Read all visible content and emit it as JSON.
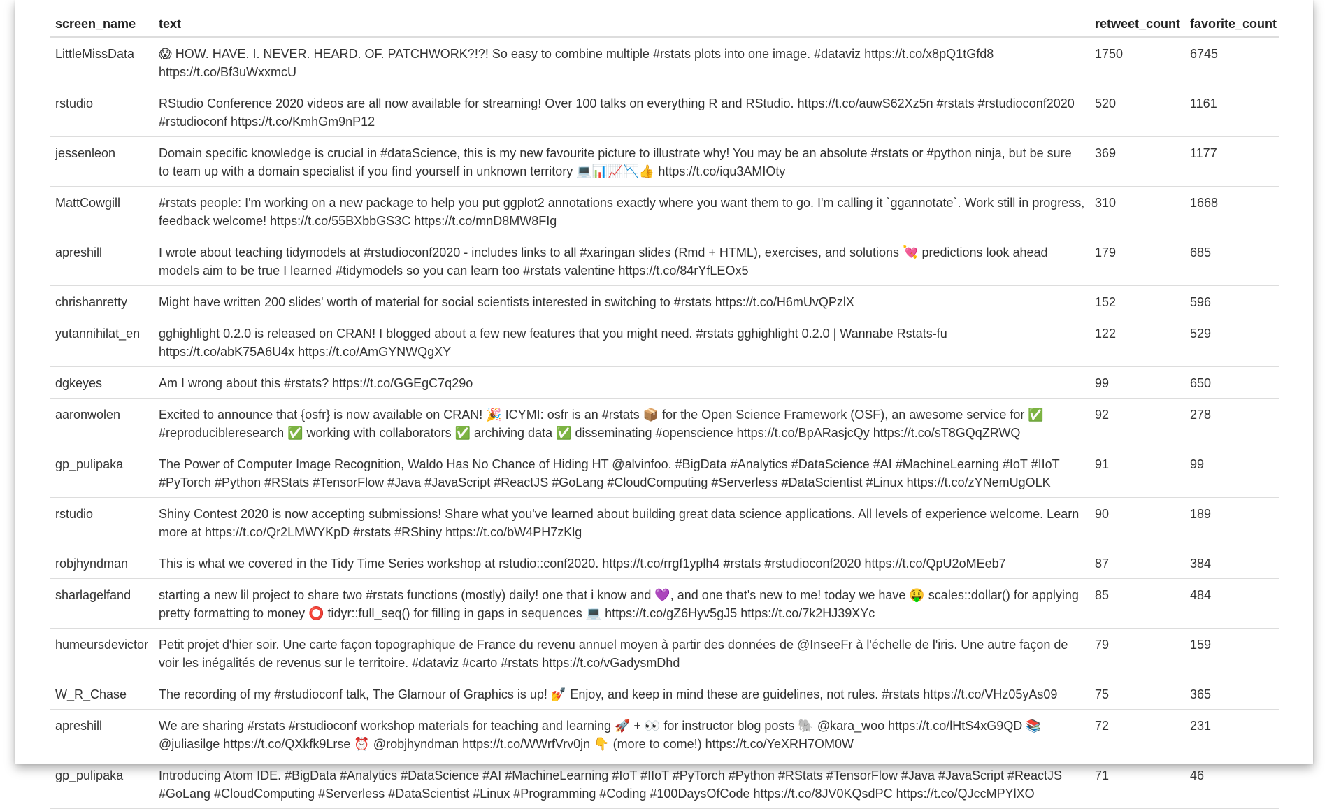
{
  "table": {
    "columns": [
      "screen_name",
      "text",
      "retweet_count",
      "favorite_count"
    ],
    "rows": [
      {
        "screen_name": "LittleMissData",
        "text": "😱 HOW. HAVE. I. NEVER. HEARD. OF. PATCHWORK?!?! So easy to combine multiple #rstats plots into one image. #dataviz https://t.co/x8pQ1tGfd8 https://t.co/Bf3uWxxmcU",
        "retweet_count": "1750",
        "favorite_count": "6745"
      },
      {
        "screen_name": "rstudio",
        "text": "RStudio Conference 2020 videos are all now available for streaming! Over 100 talks on everything R and RStudio. https://t.co/auwS62Xz5n #rstats #rstudioconf2020 #rstudioconf https://t.co/KmhGm9nP12",
        "retweet_count": "520",
        "favorite_count": "1161"
      },
      {
        "screen_name": "jessenleon",
        "text": "Domain specific knowledge is crucial in #dataScience, this is my new favourite picture to illustrate why! You may be an absolute #rstats or #python ninja, but be sure to team up with a domain specialist if you find yourself in unknown territory 💻📊📈📉👍 https://t.co/iqu3AMIOty",
        "retweet_count": "369",
        "favorite_count": "1177"
      },
      {
        "screen_name": "MattCowgill",
        "text": "#rstats people: I'm working on a new package to help you put ggplot2 annotations exactly where you want them to go. I'm calling it `ggannotate`. Work still in progress, feedback welcome! https://t.co/55BXbbGS3C https://t.co/mnD8MW8FIg",
        "retweet_count": "310",
        "favorite_count": "1668"
      },
      {
        "screen_name": "apreshill",
        "text": "I wrote about teaching tidymodels at #rstudioconf2020 - includes links to all #xaringan slides (Rmd + HTML), exercises, and solutions 💘 predictions look ahead models aim to be true I learned #tidymodels so you can learn too #rstats valentine https://t.co/84rYfLEOx5",
        "retweet_count": "179",
        "favorite_count": "685"
      },
      {
        "screen_name": "chrishanretty",
        "text": "Might have written 200 slides' worth of material for social scientists interested in switching to #rstats https://t.co/H6mUvQPzlX",
        "retweet_count": "152",
        "favorite_count": "596"
      },
      {
        "screen_name": "yutannihilat_en",
        "text": "gghighlight 0.2.0 is released on CRAN! I blogged about a few new features that you might need. #rstats gghighlight 0.2.0 | Wannabe Rstats-fu https://t.co/abK75A6U4x https://t.co/AmGYNWQgXY",
        "retweet_count": "122",
        "favorite_count": "529"
      },
      {
        "screen_name": "dgkeyes",
        "text": "Am I wrong about this #rstats? https://t.co/GGEgC7q29o",
        "retweet_count": "99",
        "favorite_count": "650"
      },
      {
        "screen_name": "aaronwolen",
        "text": "Excited to announce that {osfr} is now available on CRAN! 🎉 ICYMI: osfr is an #rstats 📦 for the Open Science Framework (OSF), an awesome service for ✅ #reproducibleresearch ✅ working with collaborators ✅ archiving data ✅ disseminating #openscience https://t.co/BpARasjcQy https://t.co/sT8GQqZRWQ",
        "retweet_count": "92",
        "favorite_count": "278"
      },
      {
        "screen_name": "gp_pulipaka",
        "text": "The Power of Computer Image Recognition, Waldo Has No Chance of Hiding HT @alvinfoo. #BigData #Analytics #DataScience #AI #MachineLearning #IoT #IIoT #PyTorch #Python #RStats #TensorFlow #Java #JavaScript #ReactJS #GoLang #CloudComputing #Serverless #DataScientist #Linux https://t.co/zYNemUgOLK",
        "retweet_count": "91",
        "favorite_count": "99"
      },
      {
        "screen_name": "rstudio",
        "text": "Shiny Contest 2020 is now accepting submissions! Share what you've learned about building great data science applications. All levels of experience welcome. Learn more at https://t.co/Qr2LMWYKpD #rstats #RShiny https://t.co/bW4PH7zKlg",
        "retweet_count": "90",
        "favorite_count": "189"
      },
      {
        "screen_name": "robjhyndman",
        "text": "This is what we covered in the Tidy Time Series workshop at rstudio::conf2020. https://t.co/rrgf1yplh4 #rstats #rstudioconf2020 https://t.co/QpU2oMEeb7",
        "retweet_count": "87",
        "favorite_count": "384"
      },
      {
        "screen_name": "sharlagelfand",
        "text": "starting a new lil project to share two #rstats functions (mostly) daily! one that i know and 💜, and one that's new to me! today we have 🤑 scales::dollar() for applying pretty formatting to money ⭕ tidyr::full_seq() for filling in gaps in sequences 💻 https://t.co/gZ6Hyv5gJ5 https://t.co/7k2HJ39XYc",
        "retweet_count": "85",
        "favorite_count": "484"
      },
      {
        "screen_name": "humeursdevictor",
        "text": "Petit projet d'hier soir. Une carte façon topographique de France du revenu annuel moyen à partir des données de @InseeFr à l'échelle de l'iris. Une autre façon de voir les inégalités de revenus sur le territoire. #dataviz #carto #rstats https://t.co/vGadysmDhd",
        "retweet_count": "79",
        "favorite_count": "159"
      },
      {
        "screen_name": "W_R_Chase",
        "text": "The recording of my #rstudioconf talk, The Glamour of Graphics is up! 💅 Enjoy, and keep in mind these are guidelines, not rules. #rstats https://t.co/VHz05yAs09",
        "retweet_count": "75",
        "favorite_count": "365"
      },
      {
        "screen_name": "apreshill",
        "text": "We are sharing #rstats #rstudioconf workshop materials for teaching and learning 🚀 + 👀 for instructor blog posts 🐘 @kara_woo https://t.co/lHtS4xG9QD 📚 @juliasilge https://t.co/QXkfk9Lrse ⏰ @robjhyndman https://t.co/WWrfVrv0jn 👇 (more to come!) https://t.co/YeXRH7OM0W",
        "retweet_count": "72",
        "favorite_count": "231"
      },
      {
        "screen_name": "gp_pulipaka",
        "text": "Introducing Atom IDE. #BigData #Analytics #DataScience #AI #MachineLearning #IoT #IIoT #PyTorch #Python #RStats #TensorFlow #Java #JavaScript #ReactJS #GoLang #CloudComputing #Serverless #DataScientist #Linux #Programming #Coding #100DaysOfCode https://t.co/8JV0KQsdPC https://t.co/QJccMPYlXO",
        "retweet_count": "71",
        "favorite_count": "46"
      }
    ]
  }
}
